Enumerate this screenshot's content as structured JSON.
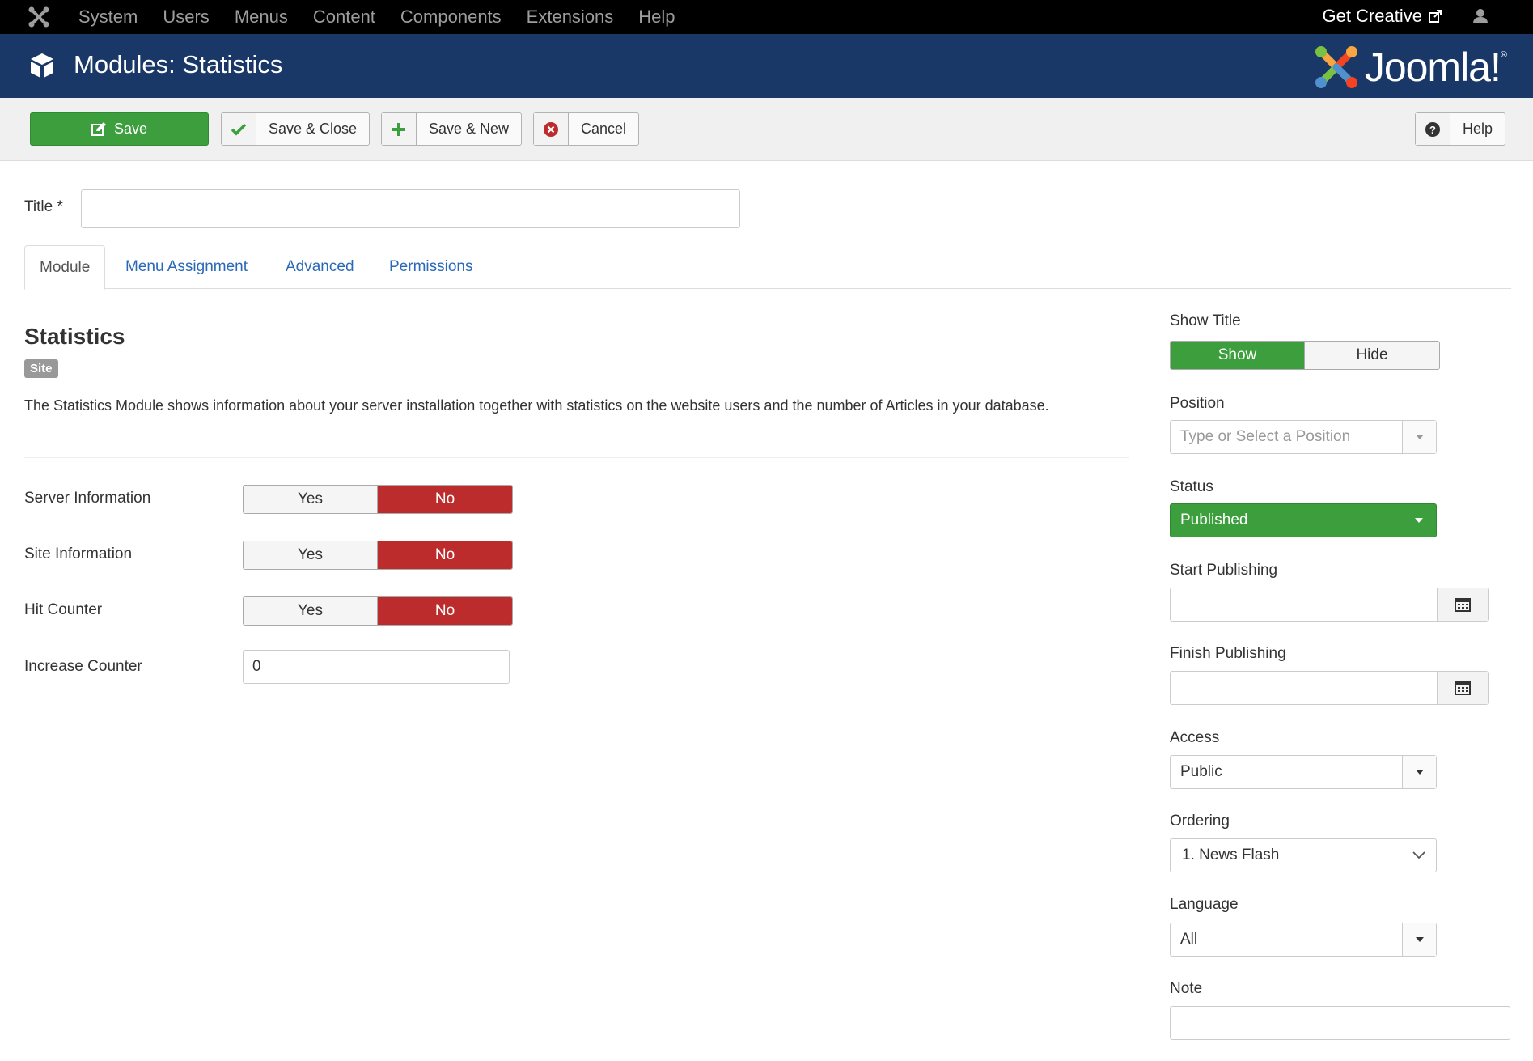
{
  "topnav": {
    "menu": [
      "System",
      "Users",
      "Menus",
      "Content",
      "Components",
      "Extensions",
      "Help"
    ],
    "get_creative": "Get Creative"
  },
  "header": {
    "page_title": "Modules: Statistics",
    "brand": "Joomla!",
    "brand_mark": "®",
    "colors": {
      "navbar": "#000000",
      "header": "#1a3867"
    }
  },
  "toolbar": {
    "save": "Save",
    "save_close": "Save & Close",
    "save_new": "Save & New",
    "cancel": "Cancel",
    "help": "Help"
  },
  "form": {
    "title_label": "Title *",
    "title_value": ""
  },
  "tabs": [
    "Module",
    "Menu Assignment",
    "Advanced",
    "Permissions"
  ],
  "module": {
    "heading": "Statistics",
    "badge": "Site",
    "description": "The Statistics Module shows information about your server installation together with statistics on the website users and the number of Articles in your database.",
    "fields": [
      {
        "label": "Server Information",
        "yes": "Yes",
        "no": "No",
        "selected": "No"
      },
      {
        "label": "Site Information",
        "yes": "Yes",
        "no": "No",
        "selected": "No"
      },
      {
        "label": "Hit Counter",
        "yes": "Yes",
        "no": "No",
        "selected": "No"
      }
    ],
    "increase_counter_label": "Increase Counter",
    "increase_counter_value": "0"
  },
  "sidebar": {
    "show_title_label": "Show Title",
    "show": "Show",
    "hide": "Hide",
    "show_title_selected": "Show",
    "position_label": "Position",
    "position_placeholder": "Type or Select a Position",
    "status_label": "Status",
    "status_value": "Published",
    "start_publishing_label": "Start Publishing",
    "start_publishing_value": "",
    "finish_publishing_label": "Finish Publishing",
    "finish_publishing_value": "",
    "access_label": "Access",
    "access_value": "Public",
    "ordering_label": "Ordering",
    "ordering_value": "1. News Flash",
    "language_label": "Language",
    "language_value": "All",
    "note_label": "Note",
    "note_value": ""
  }
}
